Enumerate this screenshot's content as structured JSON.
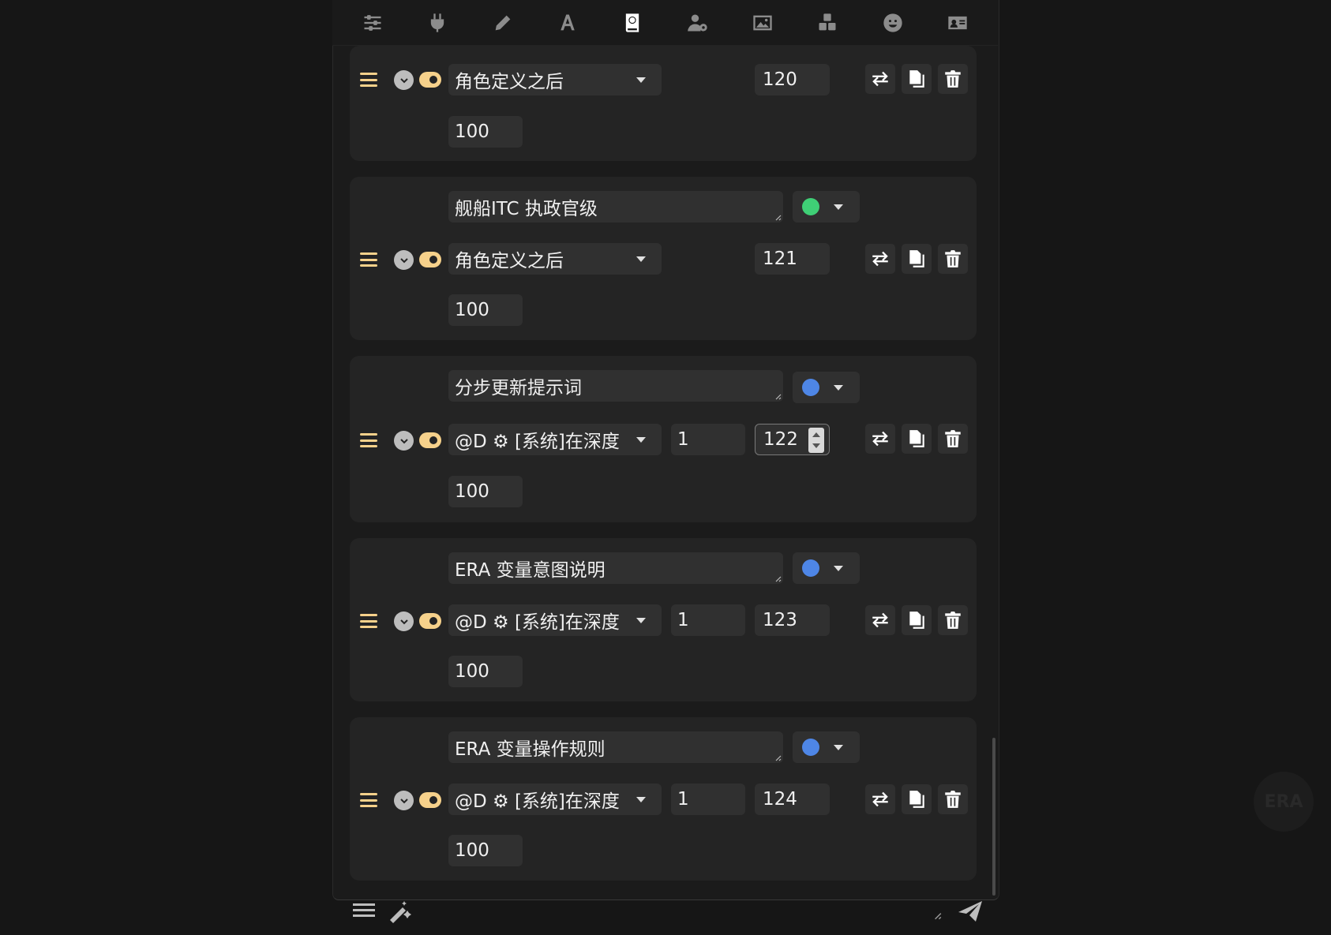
{
  "toolbar": {
    "icons": [
      "sliders-icon",
      "plug-icon",
      "pencil-icon",
      "font-icon",
      "book-atlas-icon",
      "user-gear-icon",
      "image-icon",
      "cubes-icon",
      "smile-icon",
      "id-card-icon"
    ],
    "active": "book-atlas-icon"
  },
  "entries": [
    {
      "title": "",
      "color": "",
      "position": "角色定义之后",
      "depth": "",
      "order": "120",
      "probability": "100"
    },
    {
      "title": "舰船ITC 执政官级",
      "color": "#3fcf76",
      "position": "角色定义之后",
      "depth": "",
      "order": "121",
      "probability": "100"
    },
    {
      "title": "分步更新提示词",
      "color": "#4e86e6",
      "position": "@D ⚙ [系统]在深度",
      "depth": "1",
      "order": "122",
      "probability": "100"
    },
    {
      "title": "ERA 变量意图说明",
      "color": "#4e86e6",
      "position": "@D ⚙ [系统]在深度",
      "depth": "1",
      "order": "123",
      "probability": "100"
    },
    {
      "title": "ERA 变量操作规则",
      "color": "#4e86e6",
      "position": "@D ⚙ [系统]在深度",
      "depth": "1",
      "order": "124",
      "probability": "100"
    }
  ],
  "fab_label": "ERA",
  "colors": {
    "accent": "#f6d18b",
    "panel": "#1b1b1b",
    "card": "#242424",
    "field": "#303030"
  }
}
